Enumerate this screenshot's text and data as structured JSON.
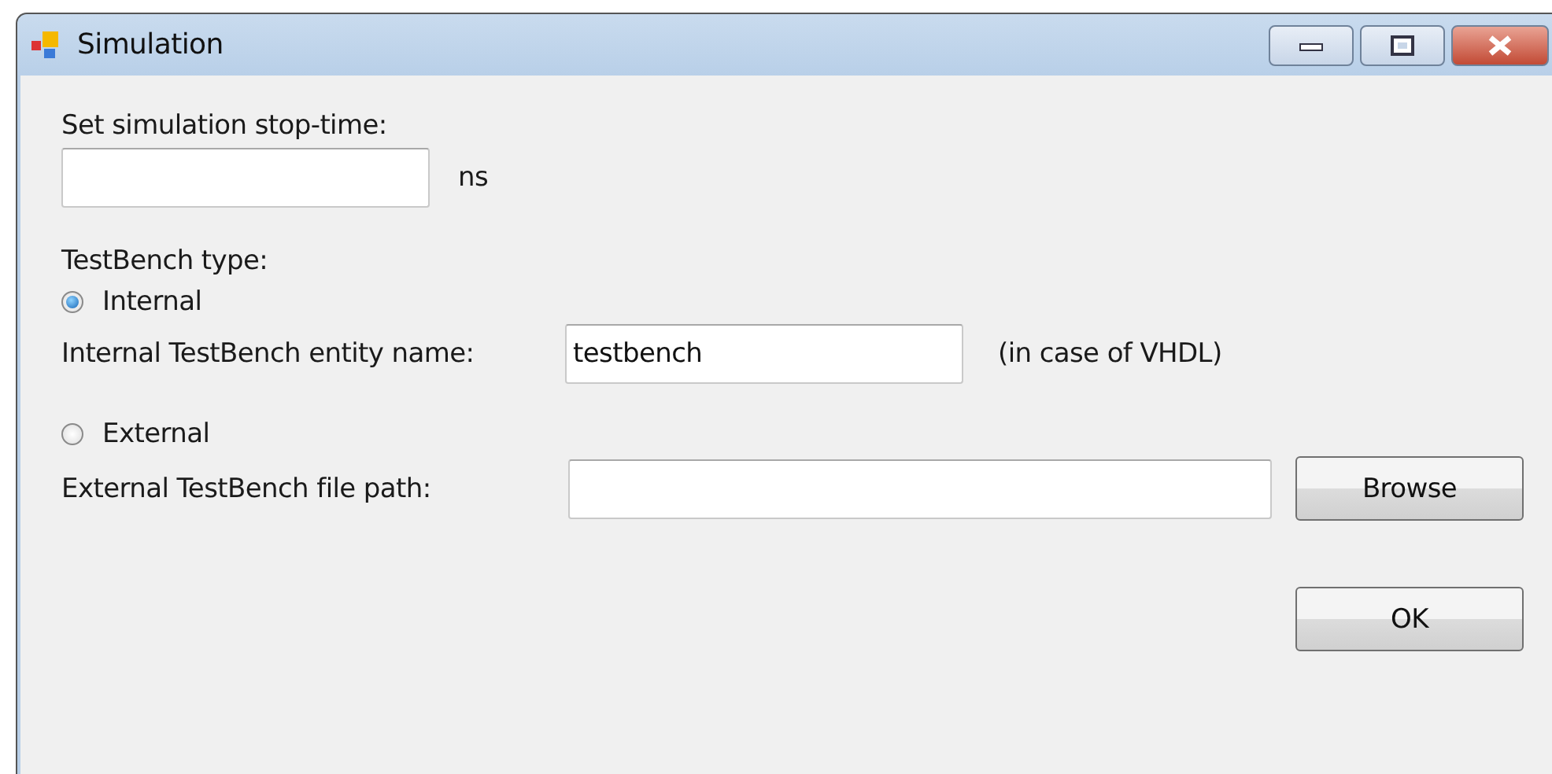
{
  "window": {
    "title": "Simulation"
  },
  "stop_time": {
    "label": "Set simulation stop-time:",
    "unit": "ns"
  },
  "testbench_type": {
    "label": "TestBench type:",
    "options": [
      {
        "label": "Internal",
        "selected": true,
        "field_label": "Internal TestBench entity name:",
        "value": "testbench",
        "note": "(in case of VHDL)"
      },
      {
        "label": "External",
        "selected": false,
        "field_label": "External TestBench file path:",
        "button": "Browse"
      }
    ]
  },
  "buttons": [
    "OK"
  ]
}
